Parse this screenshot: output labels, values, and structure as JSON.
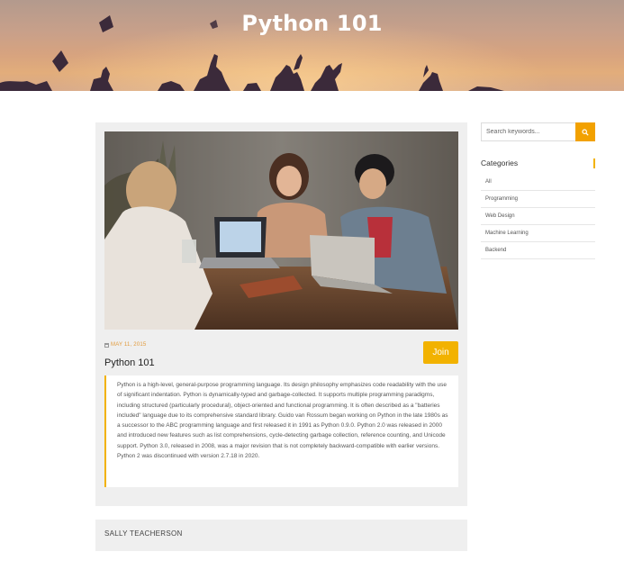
{
  "hero": {
    "title": "Python 101"
  },
  "course": {
    "date": "MAY 11, 2015",
    "title": "Python 101",
    "join_label": "Join",
    "description": "Python is a high-level, general-purpose programming language. Its design philosophy emphasizes code readability with the use of significant indentation. Python is dynamically-typed and garbage-collected. It supports multiple programming paradigms, including structured (particularly procedural), object-oriented and functional programming. It is often described as a \"batteries included\" language due to its comprehensive standard library. Guido van Rossum began working on Python in the late 1980s as a successor to the ABC programming language and first released it in 1991 as Python 0.9.0. Python 2.0 was released in 2000 and introduced new features such as list comprehensions, cycle-detecting garbage collection, reference counting, and Unicode support. Python 3.0, released in 2008, was a major revision that is not completely backward-compatible with earlier versions. Python 2 was discontinued with version 2.7.18 in 2020."
  },
  "instructor": {
    "name": "SALLY TEACHERSON"
  },
  "sidebar": {
    "search": {
      "placeholder": "Search keywords...",
      "icon": "search-icon"
    },
    "categories_heading": "Categories",
    "categories": [
      {
        "label": "All"
      },
      {
        "label": "Programming"
      },
      {
        "label": "Web Design"
      },
      {
        "label": "Machine Learning"
      },
      {
        "label": "Backend"
      }
    ]
  },
  "colors": {
    "accent": "#f2b200",
    "search_button": "#f2a100",
    "card_bg": "#efefef",
    "date": "#e19a3b"
  }
}
